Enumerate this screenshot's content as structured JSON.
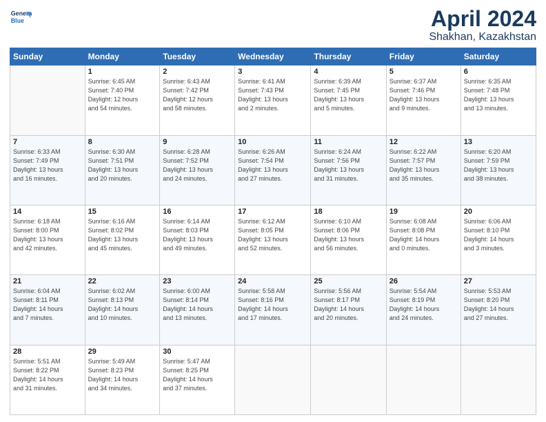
{
  "header": {
    "logo_line1": "General",
    "logo_line2": "Blue",
    "title": "April 2024",
    "subtitle": "Shakhan, Kazakhstan"
  },
  "weekdays": [
    "Sunday",
    "Monday",
    "Tuesday",
    "Wednesday",
    "Thursday",
    "Friday",
    "Saturday"
  ],
  "weeks": [
    [
      {
        "day": "",
        "info": ""
      },
      {
        "day": "1",
        "info": "Sunrise: 6:45 AM\nSunset: 7:40 PM\nDaylight: 12 hours\nand 54 minutes."
      },
      {
        "day": "2",
        "info": "Sunrise: 6:43 AM\nSunset: 7:42 PM\nDaylight: 12 hours\nand 58 minutes."
      },
      {
        "day": "3",
        "info": "Sunrise: 6:41 AM\nSunset: 7:43 PM\nDaylight: 13 hours\nand 2 minutes."
      },
      {
        "day": "4",
        "info": "Sunrise: 6:39 AM\nSunset: 7:45 PM\nDaylight: 13 hours\nand 5 minutes."
      },
      {
        "day": "5",
        "info": "Sunrise: 6:37 AM\nSunset: 7:46 PM\nDaylight: 13 hours\nand 9 minutes."
      },
      {
        "day": "6",
        "info": "Sunrise: 6:35 AM\nSunset: 7:48 PM\nDaylight: 13 hours\nand 13 minutes."
      }
    ],
    [
      {
        "day": "7",
        "info": "Sunrise: 6:33 AM\nSunset: 7:49 PM\nDaylight: 13 hours\nand 16 minutes."
      },
      {
        "day": "8",
        "info": "Sunrise: 6:30 AM\nSunset: 7:51 PM\nDaylight: 13 hours\nand 20 minutes."
      },
      {
        "day": "9",
        "info": "Sunrise: 6:28 AM\nSunset: 7:52 PM\nDaylight: 13 hours\nand 24 minutes."
      },
      {
        "day": "10",
        "info": "Sunrise: 6:26 AM\nSunset: 7:54 PM\nDaylight: 13 hours\nand 27 minutes."
      },
      {
        "day": "11",
        "info": "Sunrise: 6:24 AM\nSunset: 7:56 PM\nDaylight: 13 hours\nand 31 minutes."
      },
      {
        "day": "12",
        "info": "Sunrise: 6:22 AM\nSunset: 7:57 PM\nDaylight: 13 hours\nand 35 minutes."
      },
      {
        "day": "13",
        "info": "Sunrise: 6:20 AM\nSunset: 7:59 PM\nDaylight: 13 hours\nand 38 minutes."
      }
    ],
    [
      {
        "day": "14",
        "info": "Sunrise: 6:18 AM\nSunset: 8:00 PM\nDaylight: 13 hours\nand 42 minutes."
      },
      {
        "day": "15",
        "info": "Sunrise: 6:16 AM\nSunset: 8:02 PM\nDaylight: 13 hours\nand 45 minutes."
      },
      {
        "day": "16",
        "info": "Sunrise: 6:14 AM\nSunset: 8:03 PM\nDaylight: 13 hours\nand 49 minutes."
      },
      {
        "day": "17",
        "info": "Sunrise: 6:12 AM\nSunset: 8:05 PM\nDaylight: 13 hours\nand 52 minutes."
      },
      {
        "day": "18",
        "info": "Sunrise: 6:10 AM\nSunset: 8:06 PM\nDaylight: 13 hours\nand 56 minutes."
      },
      {
        "day": "19",
        "info": "Sunrise: 6:08 AM\nSunset: 8:08 PM\nDaylight: 14 hours\nand 0 minutes."
      },
      {
        "day": "20",
        "info": "Sunrise: 6:06 AM\nSunset: 8:10 PM\nDaylight: 14 hours\nand 3 minutes."
      }
    ],
    [
      {
        "day": "21",
        "info": "Sunrise: 6:04 AM\nSunset: 8:11 PM\nDaylight: 14 hours\nand 7 minutes."
      },
      {
        "day": "22",
        "info": "Sunrise: 6:02 AM\nSunset: 8:13 PM\nDaylight: 14 hours\nand 10 minutes."
      },
      {
        "day": "23",
        "info": "Sunrise: 6:00 AM\nSunset: 8:14 PM\nDaylight: 14 hours\nand 13 minutes."
      },
      {
        "day": "24",
        "info": "Sunrise: 5:58 AM\nSunset: 8:16 PM\nDaylight: 14 hours\nand 17 minutes."
      },
      {
        "day": "25",
        "info": "Sunrise: 5:56 AM\nSunset: 8:17 PM\nDaylight: 14 hours\nand 20 minutes."
      },
      {
        "day": "26",
        "info": "Sunrise: 5:54 AM\nSunset: 8:19 PM\nDaylight: 14 hours\nand 24 minutes."
      },
      {
        "day": "27",
        "info": "Sunrise: 5:53 AM\nSunset: 8:20 PM\nDaylight: 14 hours\nand 27 minutes."
      }
    ],
    [
      {
        "day": "28",
        "info": "Sunrise: 5:51 AM\nSunset: 8:22 PM\nDaylight: 14 hours\nand 31 minutes."
      },
      {
        "day": "29",
        "info": "Sunrise: 5:49 AM\nSunset: 8:23 PM\nDaylight: 14 hours\nand 34 minutes."
      },
      {
        "day": "30",
        "info": "Sunrise: 5:47 AM\nSunset: 8:25 PM\nDaylight: 14 hours\nand 37 minutes."
      },
      {
        "day": "",
        "info": ""
      },
      {
        "day": "",
        "info": ""
      },
      {
        "day": "",
        "info": ""
      },
      {
        "day": "",
        "info": ""
      }
    ]
  ]
}
